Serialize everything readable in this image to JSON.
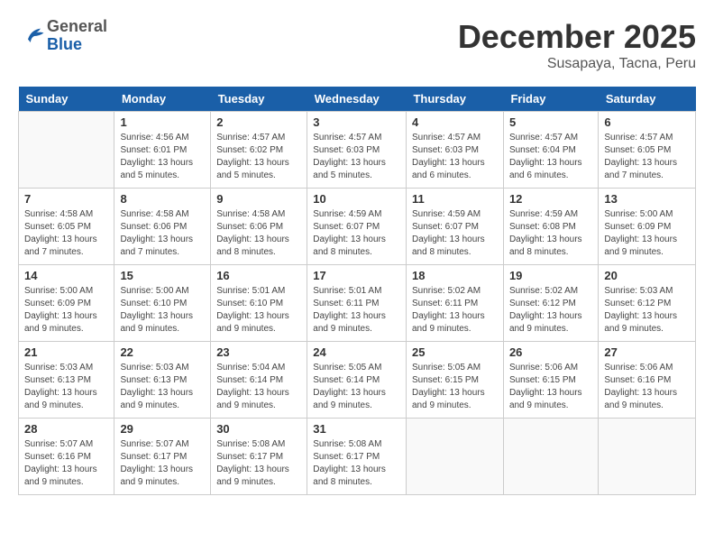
{
  "header": {
    "logo": {
      "general": "General",
      "blue": "Blue"
    },
    "title": "December 2025",
    "location": "Susapaya, Tacna, Peru"
  },
  "days_of_week": [
    "Sunday",
    "Monday",
    "Tuesday",
    "Wednesday",
    "Thursday",
    "Friday",
    "Saturday"
  ],
  "weeks": [
    [
      {
        "day": "",
        "sunrise": "",
        "sunset": "",
        "daylight": ""
      },
      {
        "day": "1",
        "sunrise": "Sunrise: 4:56 AM",
        "sunset": "Sunset: 6:01 PM",
        "daylight": "Daylight: 13 hours and 5 minutes."
      },
      {
        "day": "2",
        "sunrise": "Sunrise: 4:57 AM",
        "sunset": "Sunset: 6:02 PM",
        "daylight": "Daylight: 13 hours and 5 minutes."
      },
      {
        "day": "3",
        "sunrise": "Sunrise: 4:57 AM",
        "sunset": "Sunset: 6:03 PM",
        "daylight": "Daylight: 13 hours and 5 minutes."
      },
      {
        "day": "4",
        "sunrise": "Sunrise: 4:57 AM",
        "sunset": "Sunset: 6:03 PM",
        "daylight": "Daylight: 13 hours and 6 minutes."
      },
      {
        "day": "5",
        "sunrise": "Sunrise: 4:57 AM",
        "sunset": "Sunset: 6:04 PM",
        "daylight": "Daylight: 13 hours and 6 minutes."
      },
      {
        "day": "6",
        "sunrise": "Sunrise: 4:57 AM",
        "sunset": "Sunset: 6:05 PM",
        "daylight": "Daylight: 13 hours and 7 minutes."
      }
    ],
    [
      {
        "day": "7",
        "sunrise": "Sunrise: 4:58 AM",
        "sunset": "Sunset: 6:05 PM",
        "daylight": "Daylight: 13 hours and 7 minutes."
      },
      {
        "day": "8",
        "sunrise": "Sunrise: 4:58 AM",
        "sunset": "Sunset: 6:06 PM",
        "daylight": "Daylight: 13 hours and 7 minutes."
      },
      {
        "day": "9",
        "sunrise": "Sunrise: 4:58 AM",
        "sunset": "Sunset: 6:06 PM",
        "daylight": "Daylight: 13 hours and 8 minutes."
      },
      {
        "day": "10",
        "sunrise": "Sunrise: 4:59 AM",
        "sunset": "Sunset: 6:07 PM",
        "daylight": "Daylight: 13 hours and 8 minutes."
      },
      {
        "day": "11",
        "sunrise": "Sunrise: 4:59 AM",
        "sunset": "Sunset: 6:07 PM",
        "daylight": "Daylight: 13 hours and 8 minutes."
      },
      {
        "day": "12",
        "sunrise": "Sunrise: 4:59 AM",
        "sunset": "Sunset: 6:08 PM",
        "daylight": "Daylight: 13 hours and 8 minutes."
      },
      {
        "day": "13",
        "sunrise": "Sunrise: 5:00 AM",
        "sunset": "Sunset: 6:09 PM",
        "daylight": "Daylight: 13 hours and 9 minutes."
      }
    ],
    [
      {
        "day": "14",
        "sunrise": "Sunrise: 5:00 AM",
        "sunset": "Sunset: 6:09 PM",
        "daylight": "Daylight: 13 hours and 9 minutes."
      },
      {
        "day": "15",
        "sunrise": "Sunrise: 5:00 AM",
        "sunset": "Sunset: 6:10 PM",
        "daylight": "Daylight: 13 hours and 9 minutes."
      },
      {
        "day": "16",
        "sunrise": "Sunrise: 5:01 AM",
        "sunset": "Sunset: 6:10 PM",
        "daylight": "Daylight: 13 hours and 9 minutes."
      },
      {
        "day": "17",
        "sunrise": "Sunrise: 5:01 AM",
        "sunset": "Sunset: 6:11 PM",
        "daylight": "Daylight: 13 hours and 9 minutes."
      },
      {
        "day": "18",
        "sunrise": "Sunrise: 5:02 AM",
        "sunset": "Sunset: 6:11 PM",
        "daylight": "Daylight: 13 hours and 9 minutes."
      },
      {
        "day": "19",
        "sunrise": "Sunrise: 5:02 AM",
        "sunset": "Sunset: 6:12 PM",
        "daylight": "Daylight: 13 hours and 9 minutes."
      },
      {
        "day": "20",
        "sunrise": "Sunrise: 5:03 AM",
        "sunset": "Sunset: 6:12 PM",
        "daylight": "Daylight: 13 hours and 9 minutes."
      }
    ],
    [
      {
        "day": "21",
        "sunrise": "Sunrise: 5:03 AM",
        "sunset": "Sunset: 6:13 PM",
        "daylight": "Daylight: 13 hours and 9 minutes."
      },
      {
        "day": "22",
        "sunrise": "Sunrise: 5:03 AM",
        "sunset": "Sunset: 6:13 PM",
        "daylight": "Daylight: 13 hours and 9 minutes."
      },
      {
        "day": "23",
        "sunrise": "Sunrise: 5:04 AM",
        "sunset": "Sunset: 6:14 PM",
        "daylight": "Daylight: 13 hours and 9 minutes."
      },
      {
        "day": "24",
        "sunrise": "Sunrise: 5:05 AM",
        "sunset": "Sunset: 6:14 PM",
        "daylight": "Daylight: 13 hours and 9 minutes."
      },
      {
        "day": "25",
        "sunrise": "Sunrise: 5:05 AM",
        "sunset": "Sunset: 6:15 PM",
        "daylight": "Daylight: 13 hours and 9 minutes."
      },
      {
        "day": "26",
        "sunrise": "Sunrise: 5:06 AM",
        "sunset": "Sunset: 6:15 PM",
        "daylight": "Daylight: 13 hours and 9 minutes."
      },
      {
        "day": "27",
        "sunrise": "Sunrise: 5:06 AM",
        "sunset": "Sunset: 6:16 PM",
        "daylight": "Daylight: 13 hours and 9 minutes."
      }
    ],
    [
      {
        "day": "28",
        "sunrise": "Sunrise: 5:07 AM",
        "sunset": "Sunset: 6:16 PM",
        "daylight": "Daylight: 13 hours and 9 minutes."
      },
      {
        "day": "29",
        "sunrise": "Sunrise: 5:07 AM",
        "sunset": "Sunset: 6:17 PM",
        "daylight": "Daylight: 13 hours and 9 minutes."
      },
      {
        "day": "30",
        "sunrise": "Sunrise: 5:08 AM",
        "sunset": "Sunset: 6:17 PM",
        "daylight": "Daylight: 13 hours and 9 minutes."
      },
      {
        "day": "31",
        "sunrise": "Sunrise: 5:08 AM",
        "sunset": "Sunset: 6:17 PM",
        "daylight": "Daylight: 13 hours and 8 minutes."
      },
      {
        "day": "",
        "sunrise": "",
        "sunset": "",
        "daylight": ""
      },
      {
        "day": "",
        "sunrise": "",
        "sunset": "",
        "daylight": ""
      },
      {
        "day": "",
        "sunrise": "",
        "sunset": "",
        "daylight": ""
      }
    ]
  ]
}
